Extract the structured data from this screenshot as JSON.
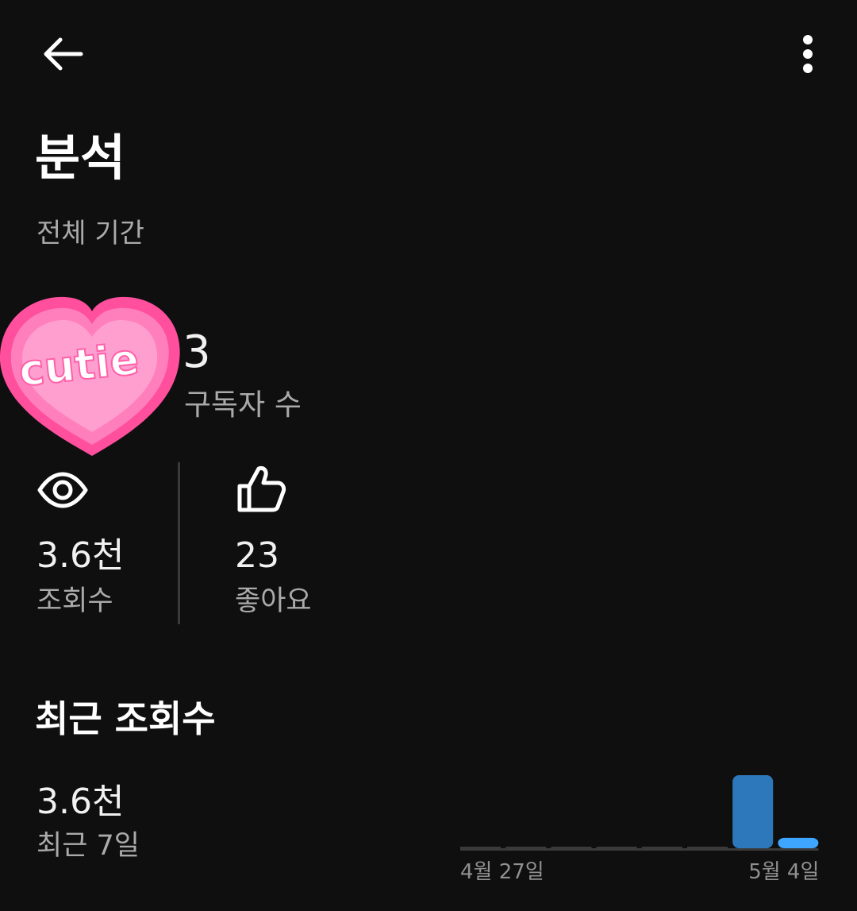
{
  "header": {
    "title": "분석",
    "period": "전체 기간"
  },
  "icons": {
    "back": "arrow-left-icon",
    "more": "more-vertical-icon",
    "views": "eye-icon",
    "likes": "thumbs-up-icon",
    "sticker": "heart-sticker"
  },
  "sticker": {
    "text": "cutie",
    "color": "#ff5fa8"
  },
  "subscribers": {
    "value": "3",
    "label": "구독자 수"
  },
  "metrics": {
    "views": {
      "value": "3.6천",
      "label": "조회수"
    },
    "likes": {
      "value": "23",
      "label": "좋아요"
    }
  },
  "recent": {
    "title": "최근 조회수",
    "value": "3.6천",
    "period": "최근 7일"
  },
  "chart_data": {
    "type": "bar",
    "categories": [
      "4월 27일",
      "",
      "",
      "",
      "",
      "",
      "",
      "5월 4일"
    ],
    "values": [
      0,
      0,
      0,
      0,
      0,
      0,
      3150,
      450
    ],
    "tick_labels": [
      "4월 27일",
      "5월 4일"
    ],
    "bar_color": "#2d78bb",
    "highlight_color": "#3ea6ff",
    "baseline_color": "#3a3a3a"
  }
}
